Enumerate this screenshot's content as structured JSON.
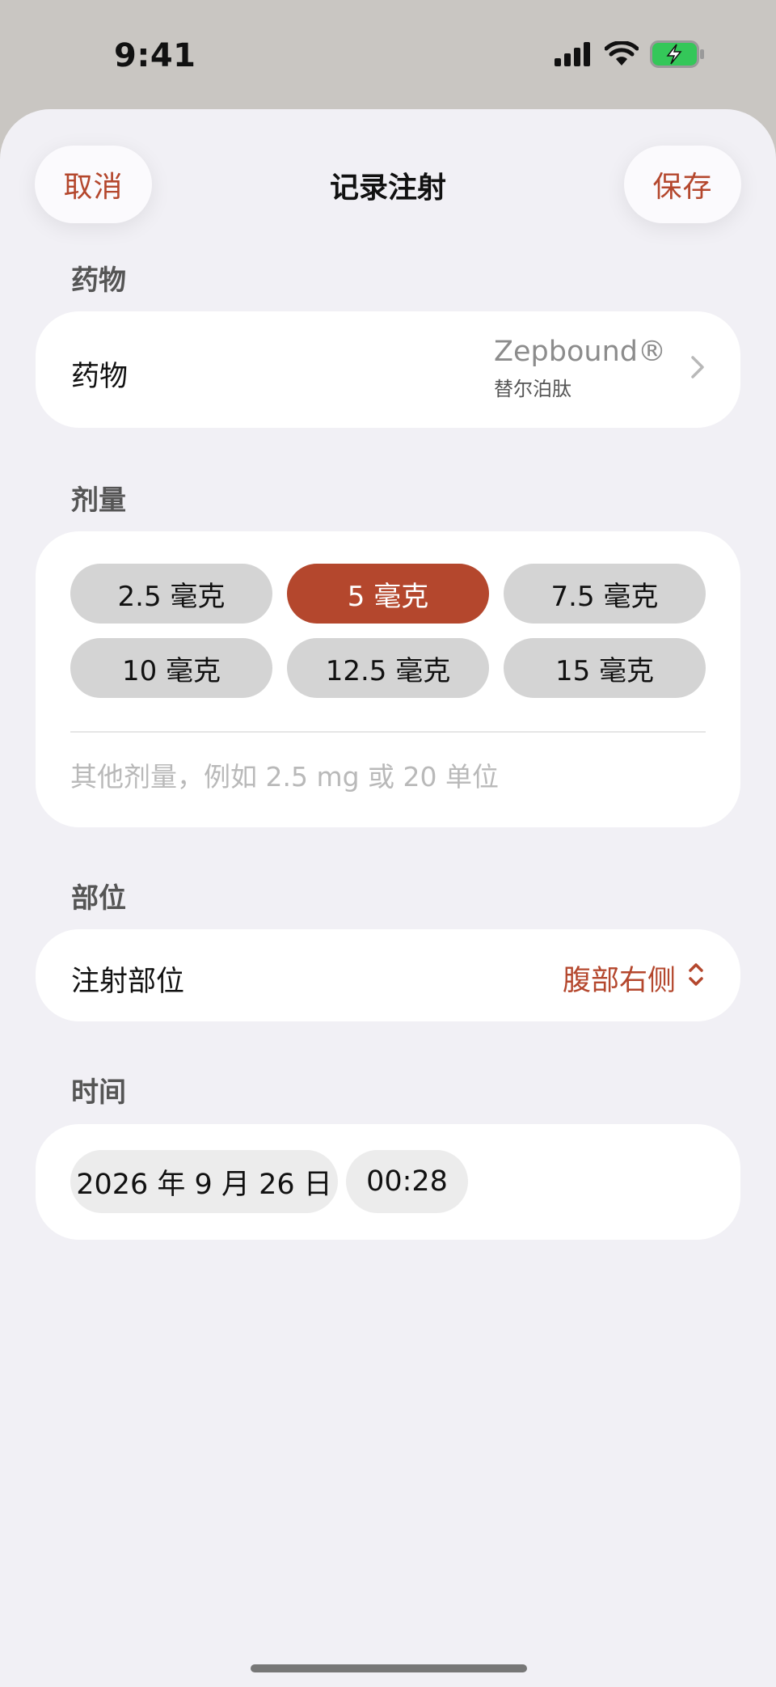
{
  "status_bar": {
    "time": "9:41",
    "icons": [
      "cellular-signal-icon",
      "wifi-icon",
      "battery-charging-icon"
    ],
    "battery_color": "#34c759"
  },
  "header": {
    "cancel_label": "取消",
    "title": "记录注射",
    "save_label": "保存"
  },
  "colors": {
    "accent": "#b4472d",
    "sheet_background": "#f1f0f5",
    "card_background": "#ffffff",
    "chip_background": "#d4d4d4"
  },
  "medication": {
    "section_label": "药物",
    "row_label": "药物",
    "name": "Zepbound®",
    "generic_name": "替尔泊肽",
    "icon": "chevron-right-icon"
  },
  "dose": {
    "section_label": "剂量",
    "options": [
      {
        "label": "2.5 毫克",
        "selected": false
      },
      {
        "label": "5 毫克",
        "selected": true
      },
      {
        "label": "7.5 毫克",
        "selected": false
      },
      {
        "label": "10 毫克",
        "selected": false
      },
      {
        "label": "12.5 毫克",
        "selected": false
      },
      {
        "label": "15 毫克",
        "selected": false
      }
    ],
    "custom_value": "",
    "custom_placeholder": "其他剂量，例如 2.5 mg 或 20 单位"
  },
  "site": {
    "section_label": "部位",
    "row_label": "注射部位",
    "value": "腹部右侧",
    "icon": "chevron-up-down-icon"
  },
  "time": {
    "section_label": "时间",
    "date": "2026 年 9 月 26 日",
    "time": "00:28"
  }
}
